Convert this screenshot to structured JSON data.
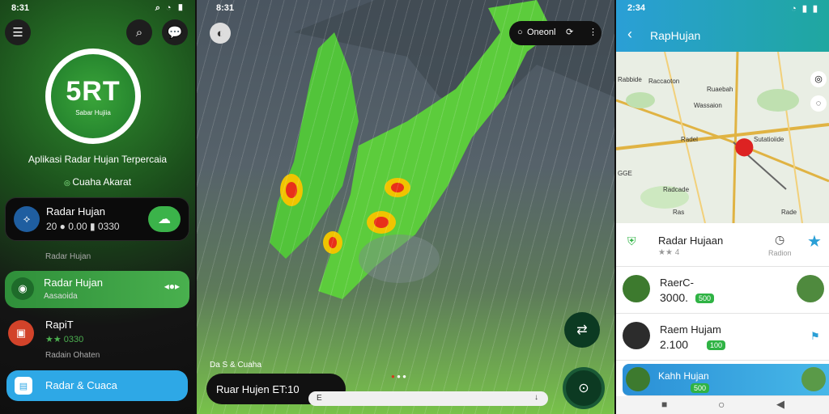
{
  "left": {
    "status": {
      "time": "8:31"
    },
    "logo": {
      "big": "5RT",
      "small": "Sabar Hujiia"
    },
    "tagline": "Aplikasi Radar Hujan Terpercaia",
    "subtagline": "Cuaha Akarat",
    "card1": {
      "title": "Radar Hujan",
      "value": "20 ● 0.00 ▮ 0330"
    },
    "section": "Radar Hujan",
    "card2": {
      "title": "Radar Hujan",
      "sub": "Aasaoida"
    },
    "card3": {
      "title": "RapiT",
      "rating": "★★ 0330",
      "sub": "Radain Ohaten"
    },
    "cta": "Radar & Cuaca"
  },
  "middle": {
    "status": {
      "time": "8:31"
    },
    "mode_label": "Oneonl",
    "small_label": "Da S & Cuaha",
    "bottom_label": "Ruar Hujen ET:10",
    "seek_left": "E",
    "seek_right": "↓"
  },
  "right": {
    "status": {
      "time": "2:34"
    },
    "title": "RapHujan",
    "map_labels": [
      "Rabbide",
      "Raccaoton",
      "Ruaebah",
      "Wassaion",
      "Radel",
      "Sutatioiide",
      "GGE",
      "Radcade",
      "Ras",
      "Rade"
    ],
    "place": {
      "title": "Radar Hujaan",
      "rating": "★★ 4",
      "right": "Radion"
    },
    "items": [
      {
        "title": "RaerC-",
        "value": "3000.",
        "badge": "500"
      },
      {
        "title": "Raem Hujam",
        "value": "2.100",
        "badge": "100"
      },
      {
        "title": "Kahh Hujan",
        "value": "",
        "badge": "500"
      }
    ]
  }
}
